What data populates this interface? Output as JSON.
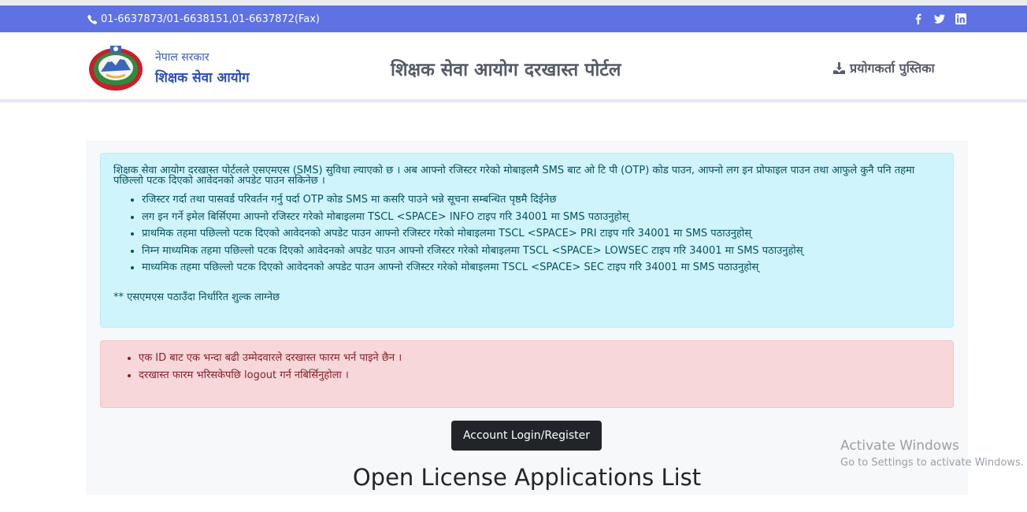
{
  "topbar": {
    "phone": "01-6637873/01-6638151,01-6637872(Fax)",
    "social_icons": [
      "facebook-icon",
      "twitter-icon",
      "linkedin-icon"
    ]
  },
  "header": {
    "gov_name": "नेपाल सरकार",
    "commission_name": "शिक्षक सेवा आयोग",
    "portal_title": "शिक्षक सेवा आयोग दरखास्त पोर्टल",
    "manual_link": "प्रयोगकर्ता पुस्तिका"
  },
  "info_alert": {
    "intro": "शिक्षक सेवा आयोग दरखास्त पोर्टलले एसएमएस (SMS) सुविधा ल्याएको छ । अब आफ्नो रजिस्टर गरेको मोबाइलमै SMS बाट ओ टि पी (OTP) कोड पाउन, आफ्नो लग इन प्रोफाइल पाउन तथा आफुले कुनै पनि तहमा पछिल्लो पटक दिएको आवेदनको अपडेट पाउन सकिनेछ ।",
    "items": [
      "रजिस्टर गर्दा तथा पासवर्ड परिवर्तन गर्नु पर्दा OTP कोड SMS मा कसरि पाउने भन्ने सूचना सम्बन्धित पृष्ठमै दिईनेछ",
      "लग इन गर्ने इमेल बिर्सिएमा आफ्नो रजिस्टर गरेको मोबाइलमा TSCL <SPACE> INFO टाइप गरि 34001 मा SMS पठाउनुहोस्",
      "प्राथमिक तहमा पछिल्लो पटक दिएको आवेदनको अपडेट पाउन आफ्नो रजिस्टर गरेको मोबाइलमा TSCL <SPACE> PRI टाइप गरि 34001 मा SMS पठाउनुहोस्",
      "निम्न माध्यमिक तहमा पछिल्लो पटक दिएको आवेदनको अपडेट पाउन आफ्नो रजिस्टर गरेको मोबाइलमा TSCL <SPACE> LOWSEC टाइप गरि 34001 मा SMS पठाउनुहोस्",
      "माध्यमिक तहमा पछिल्लो पटक दिएको आवेदनको अपडेट पाउन आफ्नो रजिस्टर गरेको मोबाइलमा TSCL <SPACE> SEC टाइप गरि 34001 मा SMS पठाउनुहोस्"
    ],
    "note": "** एसएमएस पठाउँदा निर्धारित शुल्क लाग्नेछ"
  },
  "danger_alert": {
    "items": [
      "एक ID बाट एक भन्दा बढी उम्मेदवारले दरखास्त फारम भर्न पाइने छैन ।",
      "दरखास्त फारम भरिसकेपछि logout गर्न नबिर्सिनुहोला ।"
    ]
  },
  "main": {
    "login_button": "Account Login/Register",
    "list_title": "Open License Applications List"
  },
  "watermark": {
    "line1": "Activate Windows",
    "line2": "Go to Settings to activate Windows."
  },
  "colors": {
    "topbar": "#5e72e4",
    "info_bg": "#cff4fc",
    "info_text": "#055160",
    "danger_bg": "#f8d7da",
    "danger_text": "#842029",
    "button": "#212529"
  }
}
